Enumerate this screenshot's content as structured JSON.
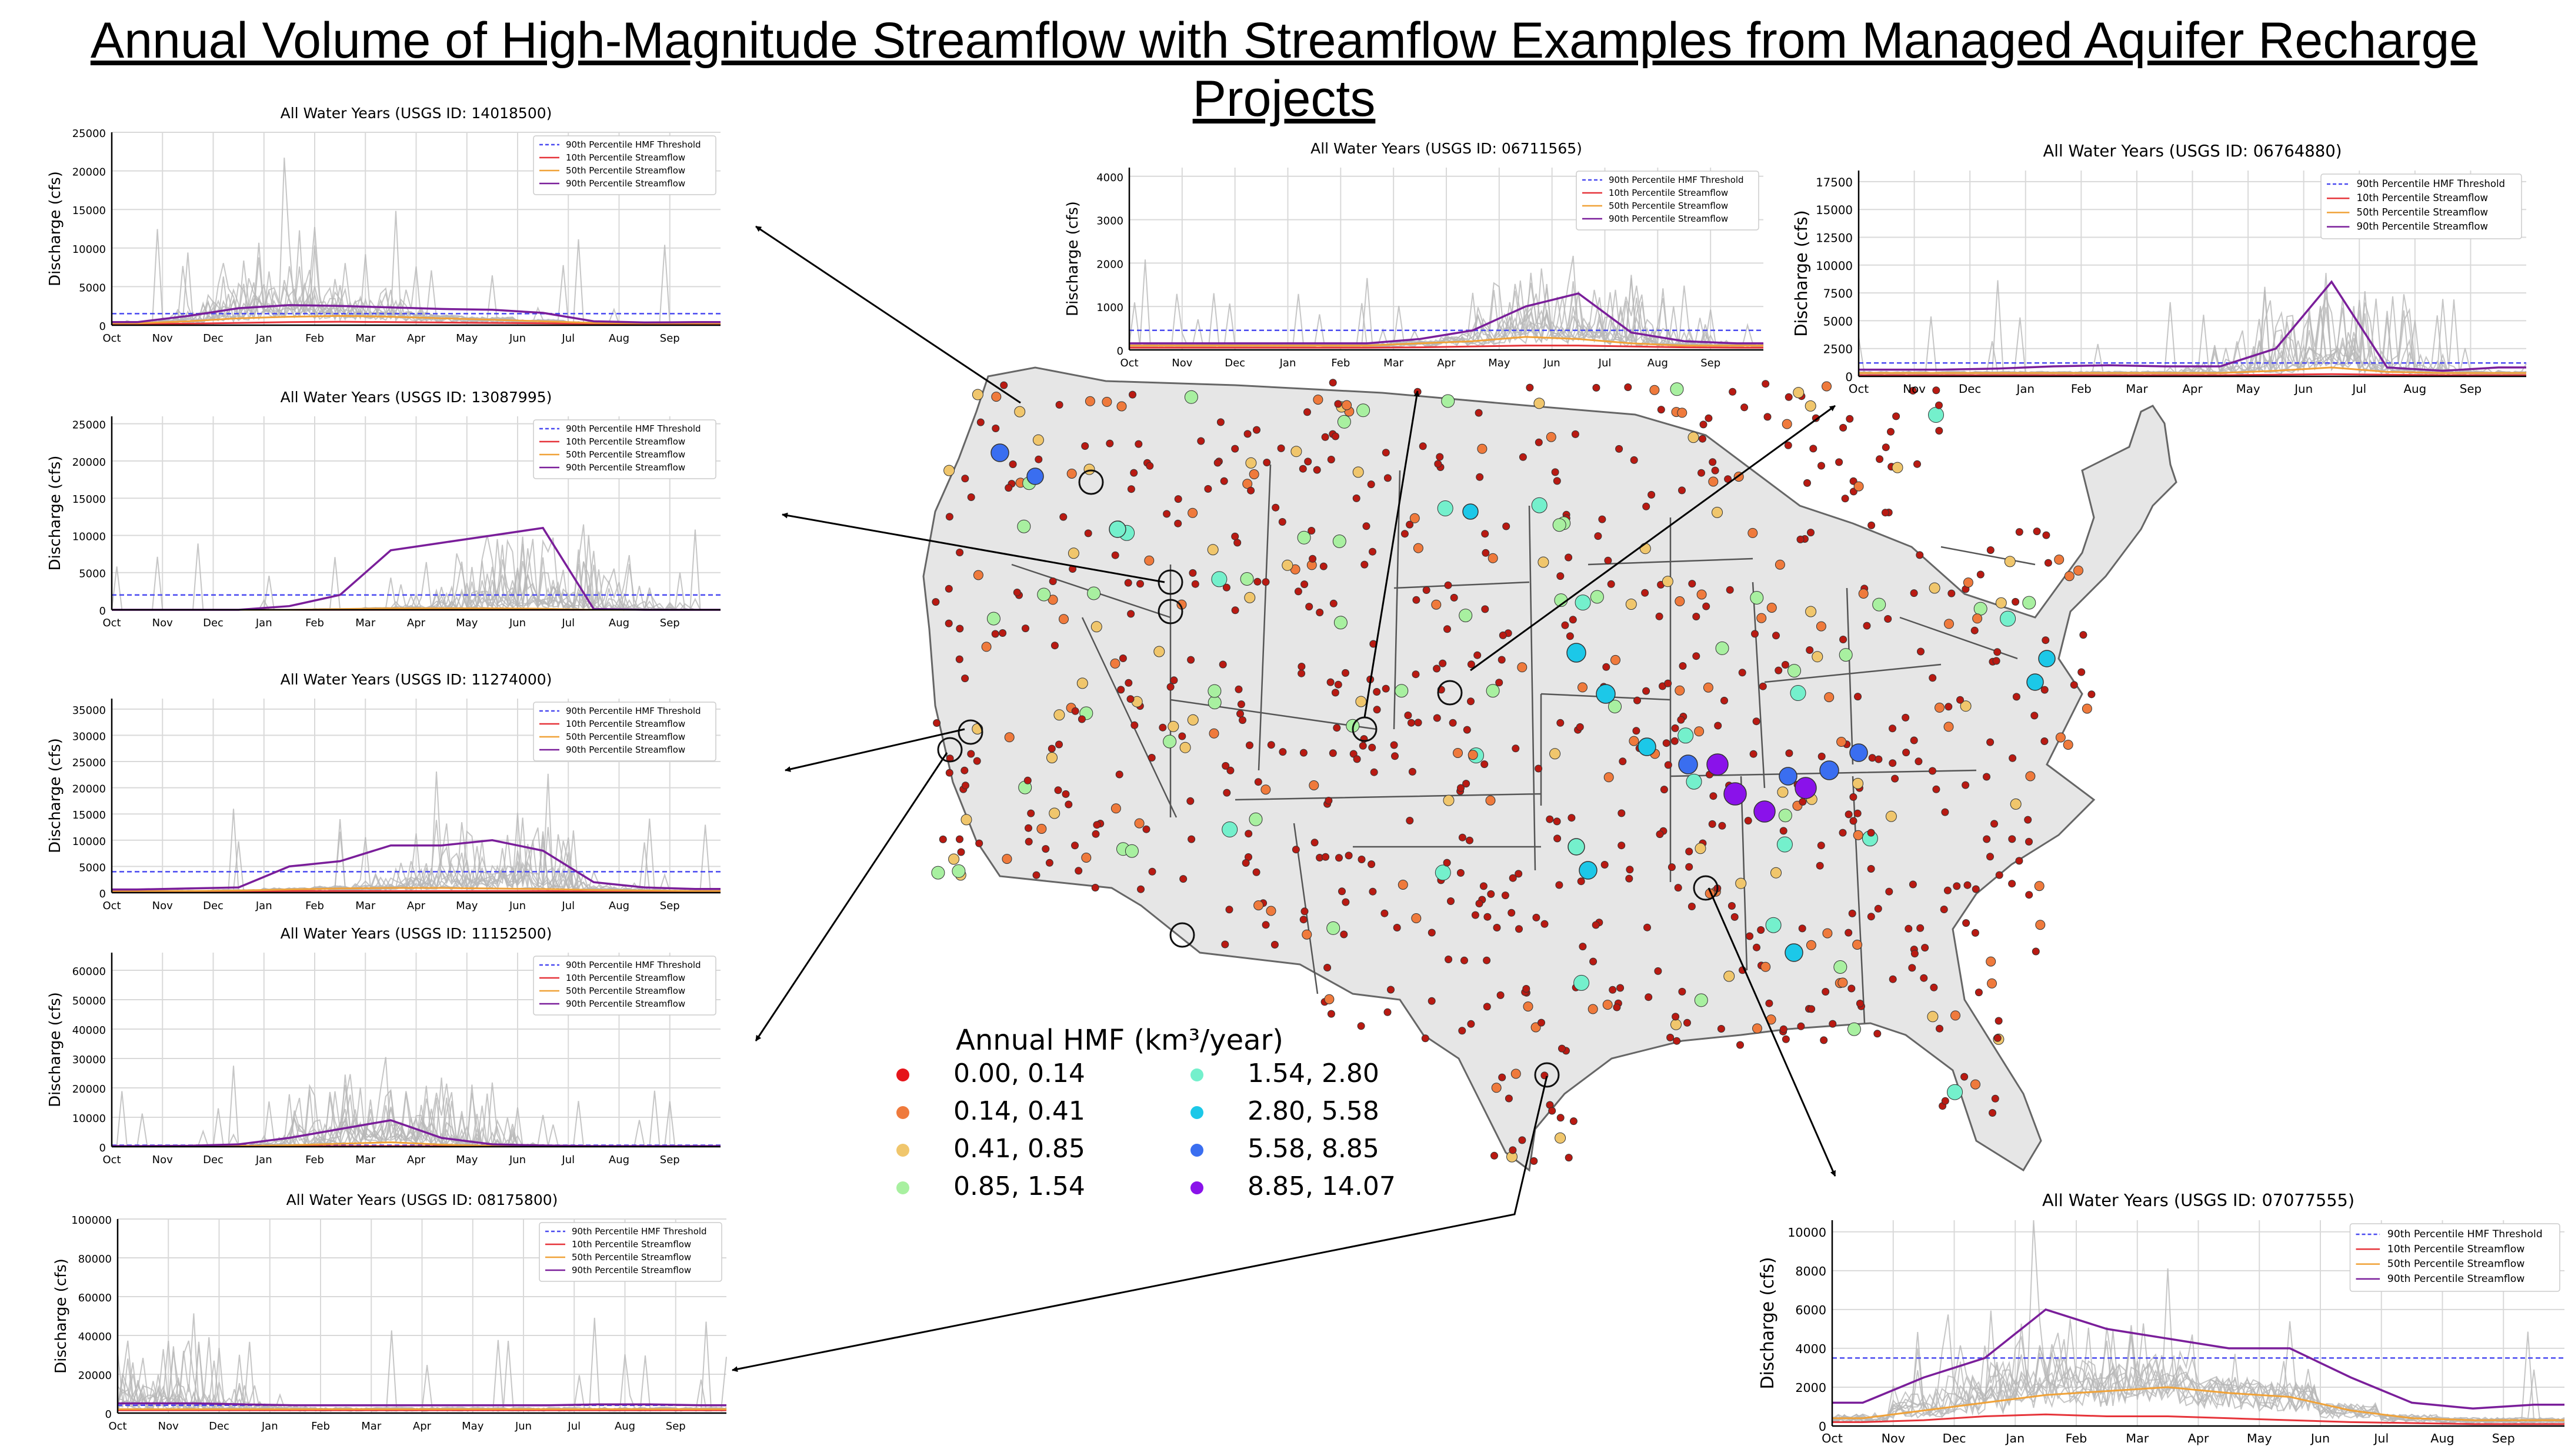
{
  "title": "Annual Volume of High-Magnitude Streamflow with Streamflow Examples from Managed Aquifer Recharge Projects",
  "colors": {
    "hmf_threshold": "#4a4af0",
    "p10": "#e6343a",
    "p50": "#f0a238",
    "p90": "#7a1e9a",
    "years": "#b8b8b8",
    "map_fill": "#e6e6e6",
    "map_stroke": "#666666"
  },
  "map": {
    "legend_title": "Annual HMF (km³/year)",
    "legend": [
      {
        "label": "0.00,  0.14",
        "color": "#e5151b"
      },
      {
        "label": "0.14,  0.41",
        "color": "#ef7a3c"
      },
      {
        "label": "0.41,  0.85",
        "color": "#f0c66c"
      },
      {
        "label": "0.85,  1.54",
        "color": "#a8f0a0"
      },
      {
        "label": "1.54,  2.80",
        "color": "#74f0cc"
      },
      {
        "label": "2.80,  5.58",
        "color": "#1cc8e8"
      },
      {
        "label": "5.58,  8.85",
        "color": "#3a6ef0"
      },
      {
        "label": "8.85, 14.07",
        "color": "#8a12ea"
      }
    ]
  },
  "chart_data": [
    {
      "type": "line",
      "title": "All Water Years (USGS ID: 14018500)",
      "ylabel": "Discharge (cfs)",
      "x": [
        "Oct",
        "Nov",
        "Dec",
        "Jan",
        "Feb",
        "Mar",
        "Apr",
        "May",
        "Jun",
        "Jul",
        "Aug",
        "Sep"
      ],
      "ylim": [
        0,
        25000
      ],
      "yticks": [
        0,
        5000,
        10000,
        15000,
        20000,
        25000
      ],
      "threshold": 1500,
      "legend": [
        "90th Percentile HMF Threshold",
        "10th Percentile Streamflow",
        "50th Percentile Streamflow",
        "90th Percentile Streamflow"
      ],
      "series": [
        {
          "name": "10th Percentile Streamflow",
          "values": [
            150,
            200,
            300,
            400,
            450,
            400,
            350,
            300,
            250,
            180,
            150,
            150
          ]
        },
        {
          "name": "50th Percentile Streamflow",
          "values": [
            250,
            500,
            900,
            1100,
            1200,
            1100,
            900,
            700,
            500,
            300,
            250,
            250
          ]
        },
        {
          "name": "90th Percentile Streamflow",
          "values": [
            400,
            1200,
            2200,
            2600,
            2500,
            2300,
            2100,
            2000,
            1600,
            500,
            350,
            400
          ]
        }
      ]
    },
    {
      "type": "line",
      "title": "All Water Years (USGS ID: 13087995)",
      "ylabel": "Discharge (cfs)",
      "x": [
        "Oct",
        "Nov",
        "Dec",
        "Jan",
        "Feb",
        "Mar",
        "Apr",
        "May",
        "Jun",
        "Jul",
        "Aug",
        "Sep"
      ],
      "ylim": [
        0,
        26000
      ],
      "yticks": [
        0,
        5000,
        10000,
        15000,
        20000,
        25000
      ],
      "threshold": 2000,
      "legend": [
        "90th Percentile HMF Threshold",
        "10th Percentile Streamflow",
        "50th Percentile Streamflow",
        "90th Percentile Streamflow"
      ],
      "series": [
        {
          "name": "10th Percentile Streamflow",
          "values": [
            0,
            0,
            0,
            0,
            0,
            0,
            0,
            0,
            0,
            0,
            0,
            0
          ]
        },
        {
          "name": "50th Percentile Streamflow",
          "values": [
            0,
            0,
            0,
            0,
            100,
            200,
            200,
            200,
            150,
            0,
            0,
            0
          ]
        },
        {
          "name": "90th Percentile Streamflow",
          "values": [
            0,
            0,
            0,
            500,
            2000,
            8000,
            9000,
            10000,
            11000,
            100,
            0,
            0
          ]
        }
      ]
    },
    {
      "type": "line",
      "title": "All Water Years (USGS ID: 11274000)",
      "ylabel": "Discharge (cfs)",
      "x": [
        "Oct",
        "Nov",
        "Dec",
        "Jan",
        "Feb",
        "Mar",
        "Apr",
        "May",
        "Jun",
        "Jul",
        "Aug",
        "Sep"
      ],
      "ylim": [
        0,
        37000
      ],
      "yticks": [
        0,
        5000,
        10000,
        15000,
        20000,
        25000,
        30000,
        35000
      ],
      "threshold": 4000,
      "legend": [
        "90th Percentile HMF Threshold",
        "10th Percentile Streamflow",
        "50th Percentile Streamflow",
        "90th Percentile Streamflow"
      ],
      "series": [
        {
          "name": "10th Percentile Streamflow",
          "values": [
            200,
            200,
            200,
            300,
            300,
            300,
            300,
            300,
            300,
            200,
            200,
            200
          ]
        },
        {
          "name": "50th Percentile Streamflow",
          "values": [
            300,
            300,
            400,
            600,
            800,
            900,
            900,
            800,
            700,
            500,
            400,
            300
          ]
        },
        {
          "name": "90th Percentile Streamflow",
          "values": [
            600,
            800,
            1000,
            5000,
            6000,
            9000,
            9000,
            10000,
            8000,
            2000,
            1000,
            700
          ]
        }
      ]
    },
    {
      "type": "line",
      "title": "All Water Years (USGS ID: 11152500)",
      "ylabel": "Discharge (cfs)",
      "x": [
        "Oct",
        "Nov",
        "Dec",
        "Jan",
        "Feb",
        "Mar",
        "Apr",
        "May",
        "Jun",
        "Jul",
        "Aug",
        "Sep"
      ],
      "ylim": [
        0,
        66000
      ],
      "yticks": [
        0,
        10000,
        20000,
        30000,
        40000,
        50000,
        60000
      ],
      "threshold": 500,
      "legend": [
        "90th Percentile HMF Threshold",
        "10th Percentile Streamflow",
        "50th Percentile Streamflow",
        "90th Percentile Streamflow"
      ],
      "series": [
        {
          "name": "10th Percentile Streamflow",
          "values": [
            100,
            100,
            100,
            150,
            200,
            200,
            150,
            100,
            100,
            100,
            100,
            100
          ]
        },
        {
          "name": "50th Percentile Streamflow",
          "values": [
            150,
            150,
            300,
            500,
            1000,
            1500,
            700,
            300,
            200,
            150,
            150,
            150
          ]
        },
        {
          "name": "90th Percentile Streamflow",
          "values": [
            200,
            300,
            800,
            3000,
            6000,
            9000,
            3000,
            800,
            400,
            200,
            200,
            200
          ]
        }
      ]
    },
    {
      "type": "line",
      "title": "All Water Years (USGS ID: 08175800)",
      "ylabel": "Discharge (cfs)",
      "x": [
        "Oct",
        "Nov",
        "Dec",
        "Jan",
        "Feb",
        "Mar",
        "Apr",
        "May",
        "Jun",
        "Jul",
        "Aug",
        "Sep"
      ],
      "ylim": [
        0,
        100000
      ],
      "yticks": [
        0,
        20000,
        40000,
        60000,
        80000,
        100000
      ],
      "threshold": 4000,
      "legend": [
        "90th Percentile HMF Threshold",
        "10th Percentile Streamflow",
        "50th Percentile Streamflow",
        "90th Percentile Streamflow"
      ],
      "series": [
        {
          "name": "10th Percentile Streamflow",
          "values": [
            1500,
            1500,
            1500,
            1500,
            1500,
            1500,
            1500,
            1500,
            1500,
            1500,
            1500,
            1500
          ]
        },
        {
          "name": "50th Percentile Streamflow",
          "values": [
            2000,
            2000,
            2000,
            2000,
            2000,
            2000,
            2000,
            2000,
            2000,
            2000,
            2000,
            2000
          ]
        },
        {
          "name": "90th Percentile Streamflow",
          "values": [
            5000,
            5000,
            4500,
            4000,
            4000,
            4000,
            4000,
            4000,
            4000,
            4500,
            4500,
            4000
          ]
        }
      ]
    },
    {
      "type": "line",
      "title": "All Water Years (USGS ID: 06711565)",
      "ylabel": "Discharge (cfs)",
      "x": [
        "Oct",
        "Nov",
        "Dec",
        "Jan",
        "Feb",
        "Mar",
        "Apr",
        "May",
        "Jun",
        "Jul",
        "Aug",
        "Sep"
      ],
      "ylim": [
        0,
        4200
      ],
      "yticks": [
        0,
        1000,
        2000,
        3000,
        4000
      ],
      "threshold": 450,
      "legend": [
        "90th Percentile HMF Threshold",
        "10th Percentile Streamflow",
        "50th Percentile Streamflow",
        "90th Percentile Streamflow"
      ],
      "series": [
        {
          "name": "10th Percentile Streamflow",
          "values": [
            50,
            50,
            50,
            50,
            50,
            60,
            80,
            100,
            100,
            80,
            60,
            50
          ]
        },
        {
          "name": "50th Percentile Streamflow",
          "values": [
            100,
            100,
            100,
            100,
            100,
            150,
            200,
            300,
            250,
            150,
            100,
            100
          ]
        },
        {
          "name": "90th Percentile Streamflow",
          "values": [
            150,
            150,
            150,
            150,
            150,
            250,
            450,
            1000,
            1300,
            400,
            200,
            150
          ]
        }
      ]
    },
    {
      "type": "line",
      "title": "All Water Years (USGS ID: 06764880)",
      "ylabel": "Discharge (cfs)",
      "x": [
        "Oct",
        "Nov",
        "Dec",
        "Jan",
        "Feb",
        "Mar",
        "Apr",
        "May",
        "Jun",
        "Jul",
        "Aug",
        "Sep"
      ],
      "ylim": [
        0,
        18500
      ],
      "yticks": [
        0,
        2500,
        5000,
        7500,
        10000,
        12500,
        15000,
        17500
      ],
      "threshold": 1200,
      "legend": [
        "90th Percentile HMF Threshold",
        "10th Percentile Streamflow",
        "50th Percentile Streamflow",
        "90th Percentile Streamflow"
      ],
      "series": [
        {
          "name": "10th Percentile Streamflow",
          "values": [
            100,
            100,
            100,
            100,
            100,
            100,
            100,
            150,
            200,
            150,
            100,
            100
          ]
        },
        {
          "name": "50th Percentile Streamflow",
          "values": [
            300,
            300,
            300,
            300,
            300,
            300,
            300,
            500,
            800,
            400,
            300,
            300
          ]
        },
        {
          "name": "90th Percentile Streamflow",
          "values": [
            600,
            600,
            700,
            900,
            1000,
            900,
            900,
            2500,
            8500,
            800,
            500,
            800
          ]
        }
      ]
    },
    {
      "type": "line",
      "title": "All Water Years (USGS ID: 07077555)",
      "ylabel": "Discharge (cfs)",
      "x": [
        "Oct",
        "Nov",
        "Dec",
        "Jan",
        "Feb",
        "Mar",
        "Apr",
        "May",
        "Jun",
        "Jul",
        "Aug",
        "Sep"
      ],
      "ylim": [
        0,
        10600
      ],
      "yticks": [
        0,
        2000,
        4000,
        6000,
        8000,
        10000
      ],
      "threshold": 3500,
      "legend": [
        "90th Percentile HMF Threshold",
        "10th Percentile Streamflow",
        "50th Percentile Streamflow",
        "90th Percentile Streamflow"
      ],
      "series": [
        {
          "name": "10th Percentile Streamflow",
          "values": [
            200,
            300,
            500,
            600,
            500,
            500,
            400,
            300,
            200,
            150,
            100,
            100
          ]
        },
        {
          "name": "50th Percentile Streamflow",
          "values": [
            400,
            800,
            1200,
            1600,
            1800,
            2000,
            1700,
            1500,
            800,
            400,
            300,
            300
          ]
        },
        {
          "name": "90th Percentile Streamflow",
          "values": [
            1200,
            2500,
            3500,
            6000,
            5000,
            4500,
            4000,
            4000,
            2500,
            1200,
            900,
            1100
          ]
        }
      ]
    }
  ]
}
